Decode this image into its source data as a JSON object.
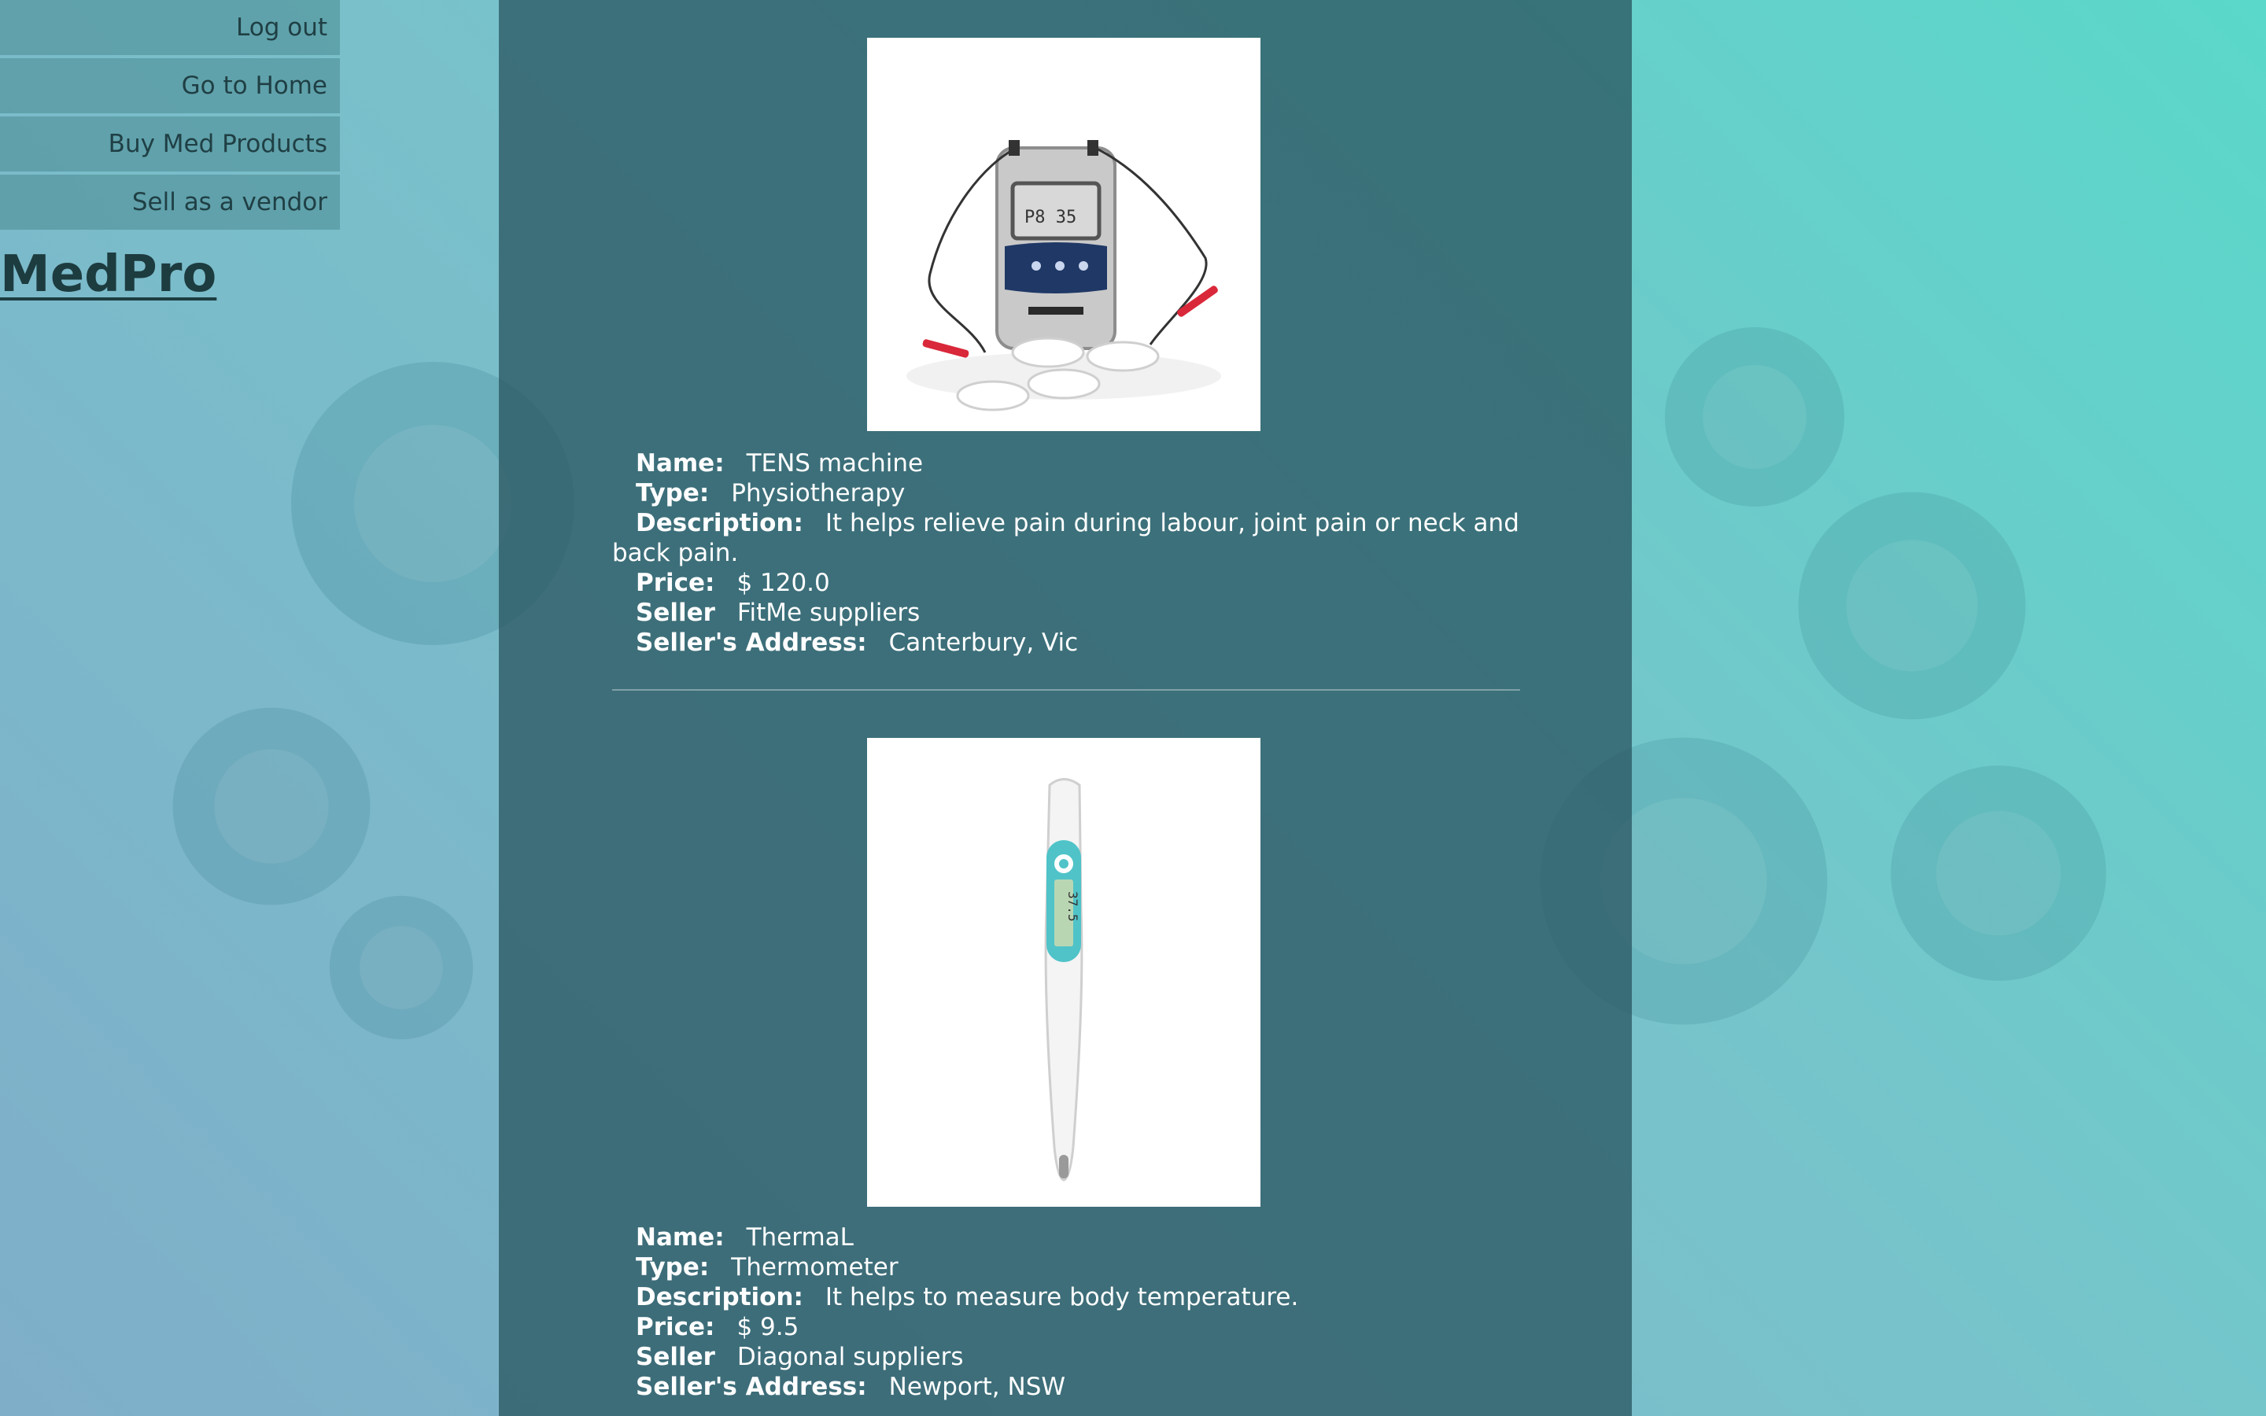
{
  "nav": {
    "items": [
      {
        "label": "Log out"
      },
      {
        "label": "Go to Home"
      },
      {
        "label": "Buy Med Products"
      },
      {
        "label": "Sell as a vendor"
      }
    ]
  },
  "brand": {
    "logo": "MedPro"
  },
  "labels": {
    "name": "Name:",
    "type": "Type:",
    "description": "Description:",
    "price": "Price:",
    "seller": "Seller",
    "address": "Seller's Address:"
  },
  "products": [
    {
      "name": "TENS machine",
      "type": "Physiotherapy",
      "description": "It helps relieve pain during labour, joint pain or neck and back pain.",
      "price": "$ 120.0",
      "seller": "FitMe suppliers",
      "address": "Canterbury, Vic",
      "image_icon": "tens-machine-image"
    },
    {
      "name": "ThermaL",
      "type": "Thermometer",
      "description": "It helps to measure body temperature.",
      "price": "$ 9.5",
      "seller": "Diagonal suppliers",
      "address": "Newport, NSW",
      "image_icon": "thermometer-image"
    }
  ],
  "colors": {
    "panel": "#2c5863",
    "accent": "#4fc3c8",
    "nav_bg": "#4a8a91"
  }
}
